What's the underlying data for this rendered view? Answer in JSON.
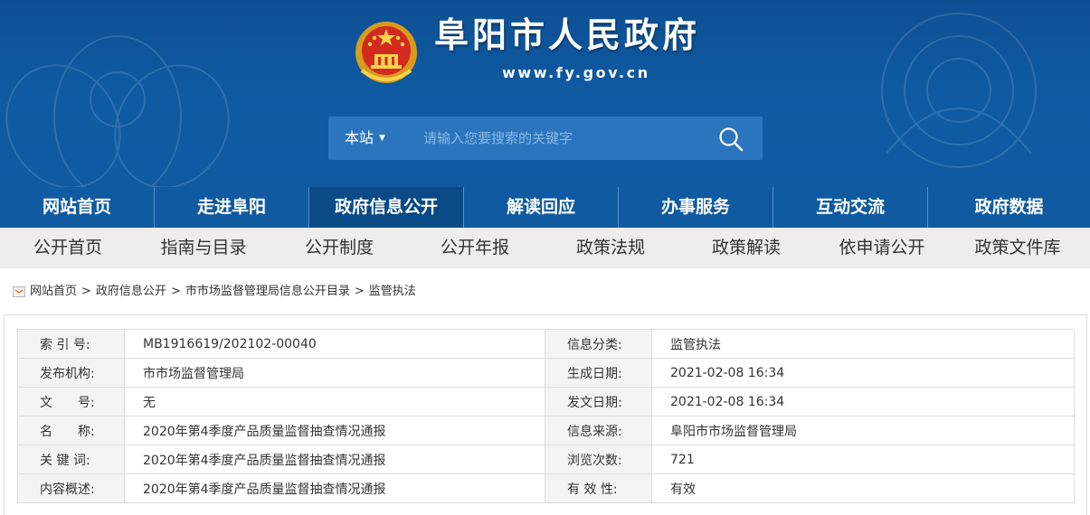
{
  "header": {
    "site_title": "阜阳市人民政府",
    "site_url": "www.fy.gov.cn"
  },
  "search": {
    "scope": "本站",
    "placeholder": "请输入您要搜索的关键字"
  },
  "main_nav": [
    {
      "label": "网站首页",
      "active": false
    },
    {
      "label": "走进阜阳",
      "active": false
    },
    {
      "label": "政府信息公开",
      "active": true
    },
    {
      "label": "解读回应",
      "active": false
    },
    {
      "label": "办事服务",
      "active": false
    },
    {
      "label": "互动交流",
      "active": false
    },
    {
      "label": "政府数据",
      "active": false
    }
  ],
  "sub_nav": [
    {
      "label": "公开首页"
    },
    {
      "label": "指南与目录"
    },
    {
      "label": "公开制度"
    },
    {
      "label": "公开年报"
    },
    {
      "label": "政策法规"
    },
    {
      "label": "政策解读"
    },
    {
      "label": "依申请公开"
    },
    {
      "label": "政策文件库"
    }
  ],
  "breadcrumb": {
    "items": [
      "网站首页",
      "政府信息公开",
      "市市场监督管理局信息公开目录",
      "监管执法"
    ],
    "separator": ">"
  },
  "info_table": {
    "rows": [
      {
        "label1": "索 引 号:",
        "value1": "MB1916619/202102-00040",
        "label2": "信息分类:",
        "value2": "监管执法"
      },
      {
        "label1": "发布机构:",
        "value1": "市市场监督管理局",
        "label2": "生成日期:",
        "value2": "2021-02-08 16:34"
      },
      {
        "label1": "文　　号:",
        "value1": "无",
        "label2": "发文日期:",
        "value2": "2021-02-08 16:34"
      },
      {
        "label1": "名　　称:",
        "value1": "2020年第4季度产品质量监督抽查情况通报",
        "label2": "信息来源:",
        "value2": "阜阳市市场监督管理局"
      },
      {
        "label1": "关 键 词:",
        "value1": "2020年第4季度产品质量监督抽查情况通报",
        "label2": "浏览次数:",
        "value2": "721"
      },
      {
        "label1": "内容概述:",
        "value1": "2020年第4季度产品质量监督抽查情况通报",
        "label2": "有 效 性:",
        "value2": "有效"
      }
    ]
  },
  "colors": {
    "banner": "#0f5aa1",
    "nav_active": "#0a4a86",
    "search_box": "#2a75bd",
    "subnav_bg": "#ededed",
    "label_cell_bg": "#f4f4f4"
  },
  "icons": {
    "emblem": "national-emblem",
    "search": "search-icon",
    "breadcrumb": "location-icon"
  }
}
